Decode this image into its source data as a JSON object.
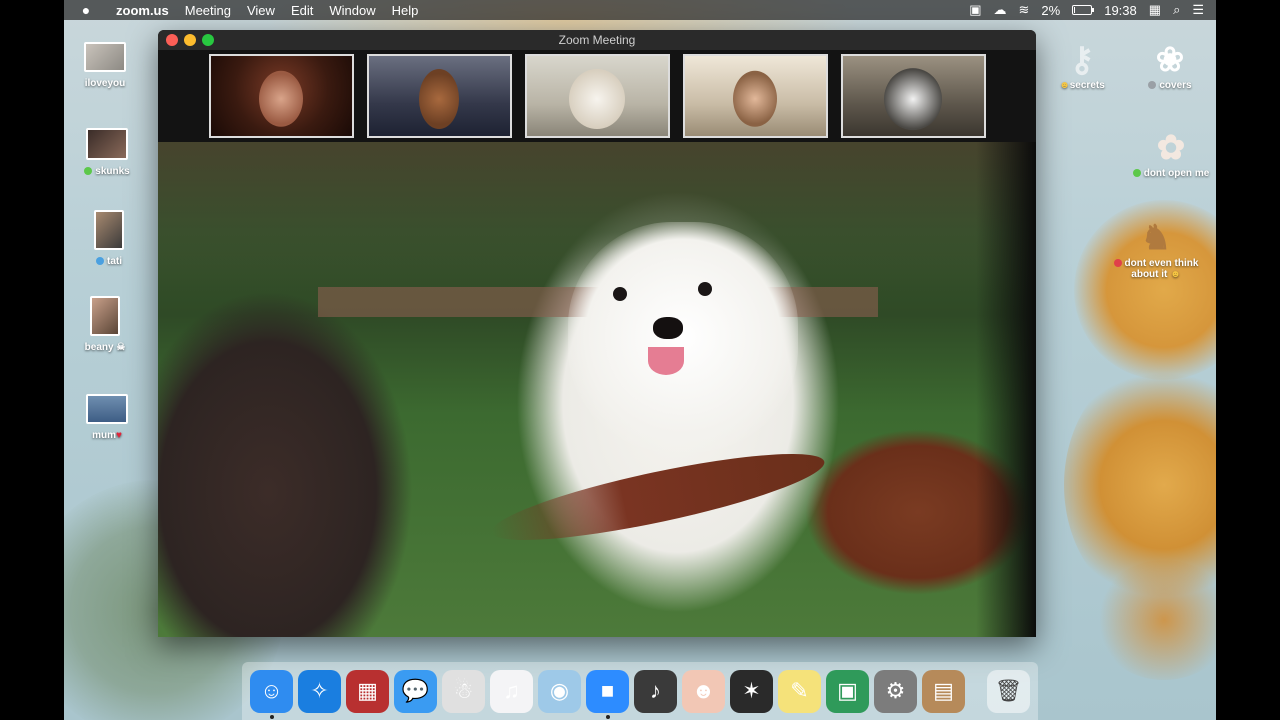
{
  "menubar": {
    "app_name": "zoom.us",
    "menus": [
      "Meeting",
      "View",
      "Edit",
      "Window",
      "Help"
    ],
    "battery_percent": "2%",
    "battery_level": 0.02,
    "time": "19:38"
  },
  "window": {
    "title": "Zoom Meeting"
  },
  "desktop_left": [
    {
      "label": "iloveyou"
    },
    {
      "label": "skunks"
    },
    {
      "label": "tati"
    },
    {
      "label": "beany"
    },
    {
      "label": "mum"
    }
  ],
  "desktop_right": [
    {
      "label": "secrets"
    },
    {
      "label": "covers"
    },
    {
      "label": "dont open me"
    },
    {
      "label": "dont even think about it"
    }
  ],
  "dock": [
    {
      "name": "finder-icon",
      "glyph": "☺",
      "color": "#2f8cf0"
    },
    {
      "name": "safari-icon",
      "glyph": "✧",
      "color": "#1a7ee0"
    },
    {
      "name": "photo-booth-icon",
      "glyph": "▦",
      "color": "#b83030"
    },
    {
      "name": "messages-icon",
      "glyph": "💬",
      "color": "#3a9bf2"
    },
    {
      "name": "mascot-icon",
      "glyph": "☃",
      "color": "#e0e0e0"
    },
    {
      "name": "music-icon",
      "glyph": "♫",
      "color": "#f4f4f6"
    },
    {
      "name": "mascot-seal-icon",
      "glyph": "◉",
      "color": "#9ec9e8"
    },
    {
      "name": "zoom-icon",
      "glyph": "■",
      "color": "#2d8cff"
    },
    {
      "name": "garageband-icon",
      "glyph": "♪",
      "color": "#3a3a3a"
    },
    {
      "name": "face-app-icon",
      "glyph": "☻",
      "color": "#f2c7b5"
    },
    {
      "name": "photo-app-icon",
      "glyph": "✶",
      "color": "#2a2a2a"
    },
    {
      "name": "stickies-icon",
      "glyph": "✎",
      "color": "#f5e27a"
    },
    {
      "name": "preview-icon",
      "glyph": "▣",
      "color": "#2f9a5a"
    },
    {
      "name": "system-preferences-icon",
      "glyph": "⚙",
      "color": "#7c7c7c"
    },
    {
      "name": "contacts-icon",
      "glyph": "▤",
      "color": "#b68a5a"
    }
  ]
}
